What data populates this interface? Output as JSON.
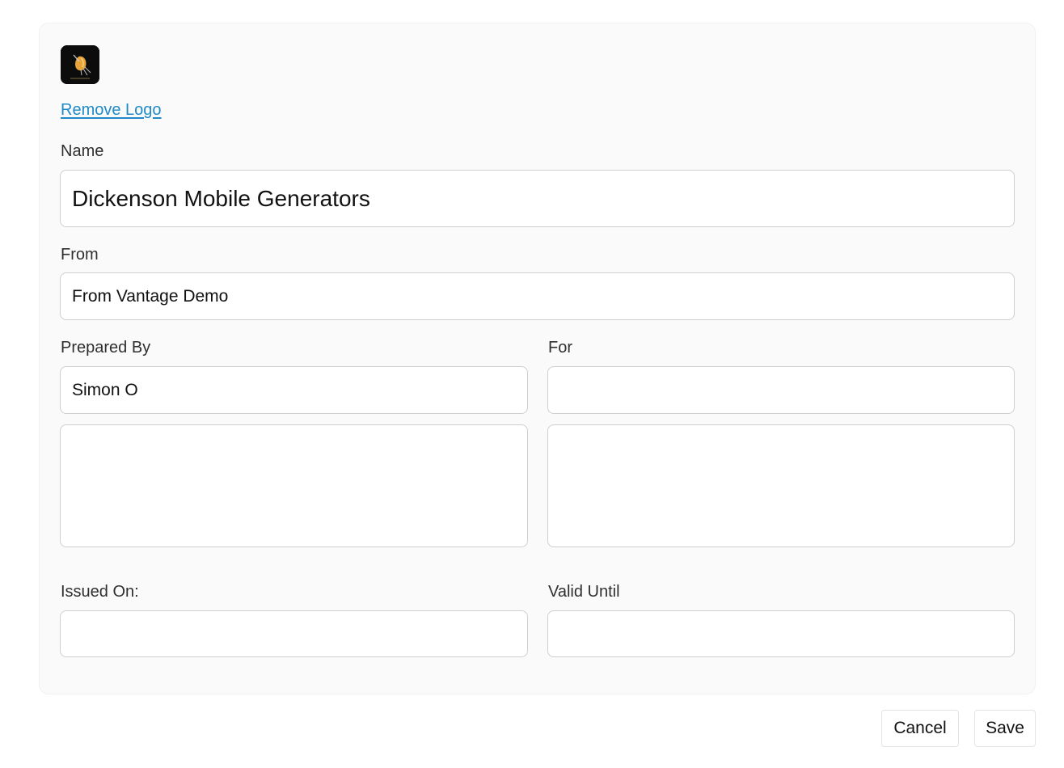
{
  "logo": {
    "icon": "bird-logo-icon"
  },
  "remove_logo_label": "Remove Logo",
  "name": {
    "label": "Name",
    "value": "Dickenson Mobile Generators"
  },
  "from": {
    "label": "From",
    "value": "From Vantage Demo"
  },
  "prepared_by": {
    "label": "Prepared By",
    "value": "Simon O",
    "details": ""
  },
  "for": {
    "label": "For",
    "value": "",
    "details": ""
  },
  "issued_on": {
    "label": "Issued On:",
    "value": ""
  },
  "valid_until": {
    "label": "Valid Until",
    "value": ""
  },
  "actions": {
    "cancel_label": "Cancel",
    "save_label": "Save"
  },
  "colors": {
    "link": "#1f8ac7",
    "card_bg": "#fafafa",
    "border": "#cfcfcf"
  }
}
